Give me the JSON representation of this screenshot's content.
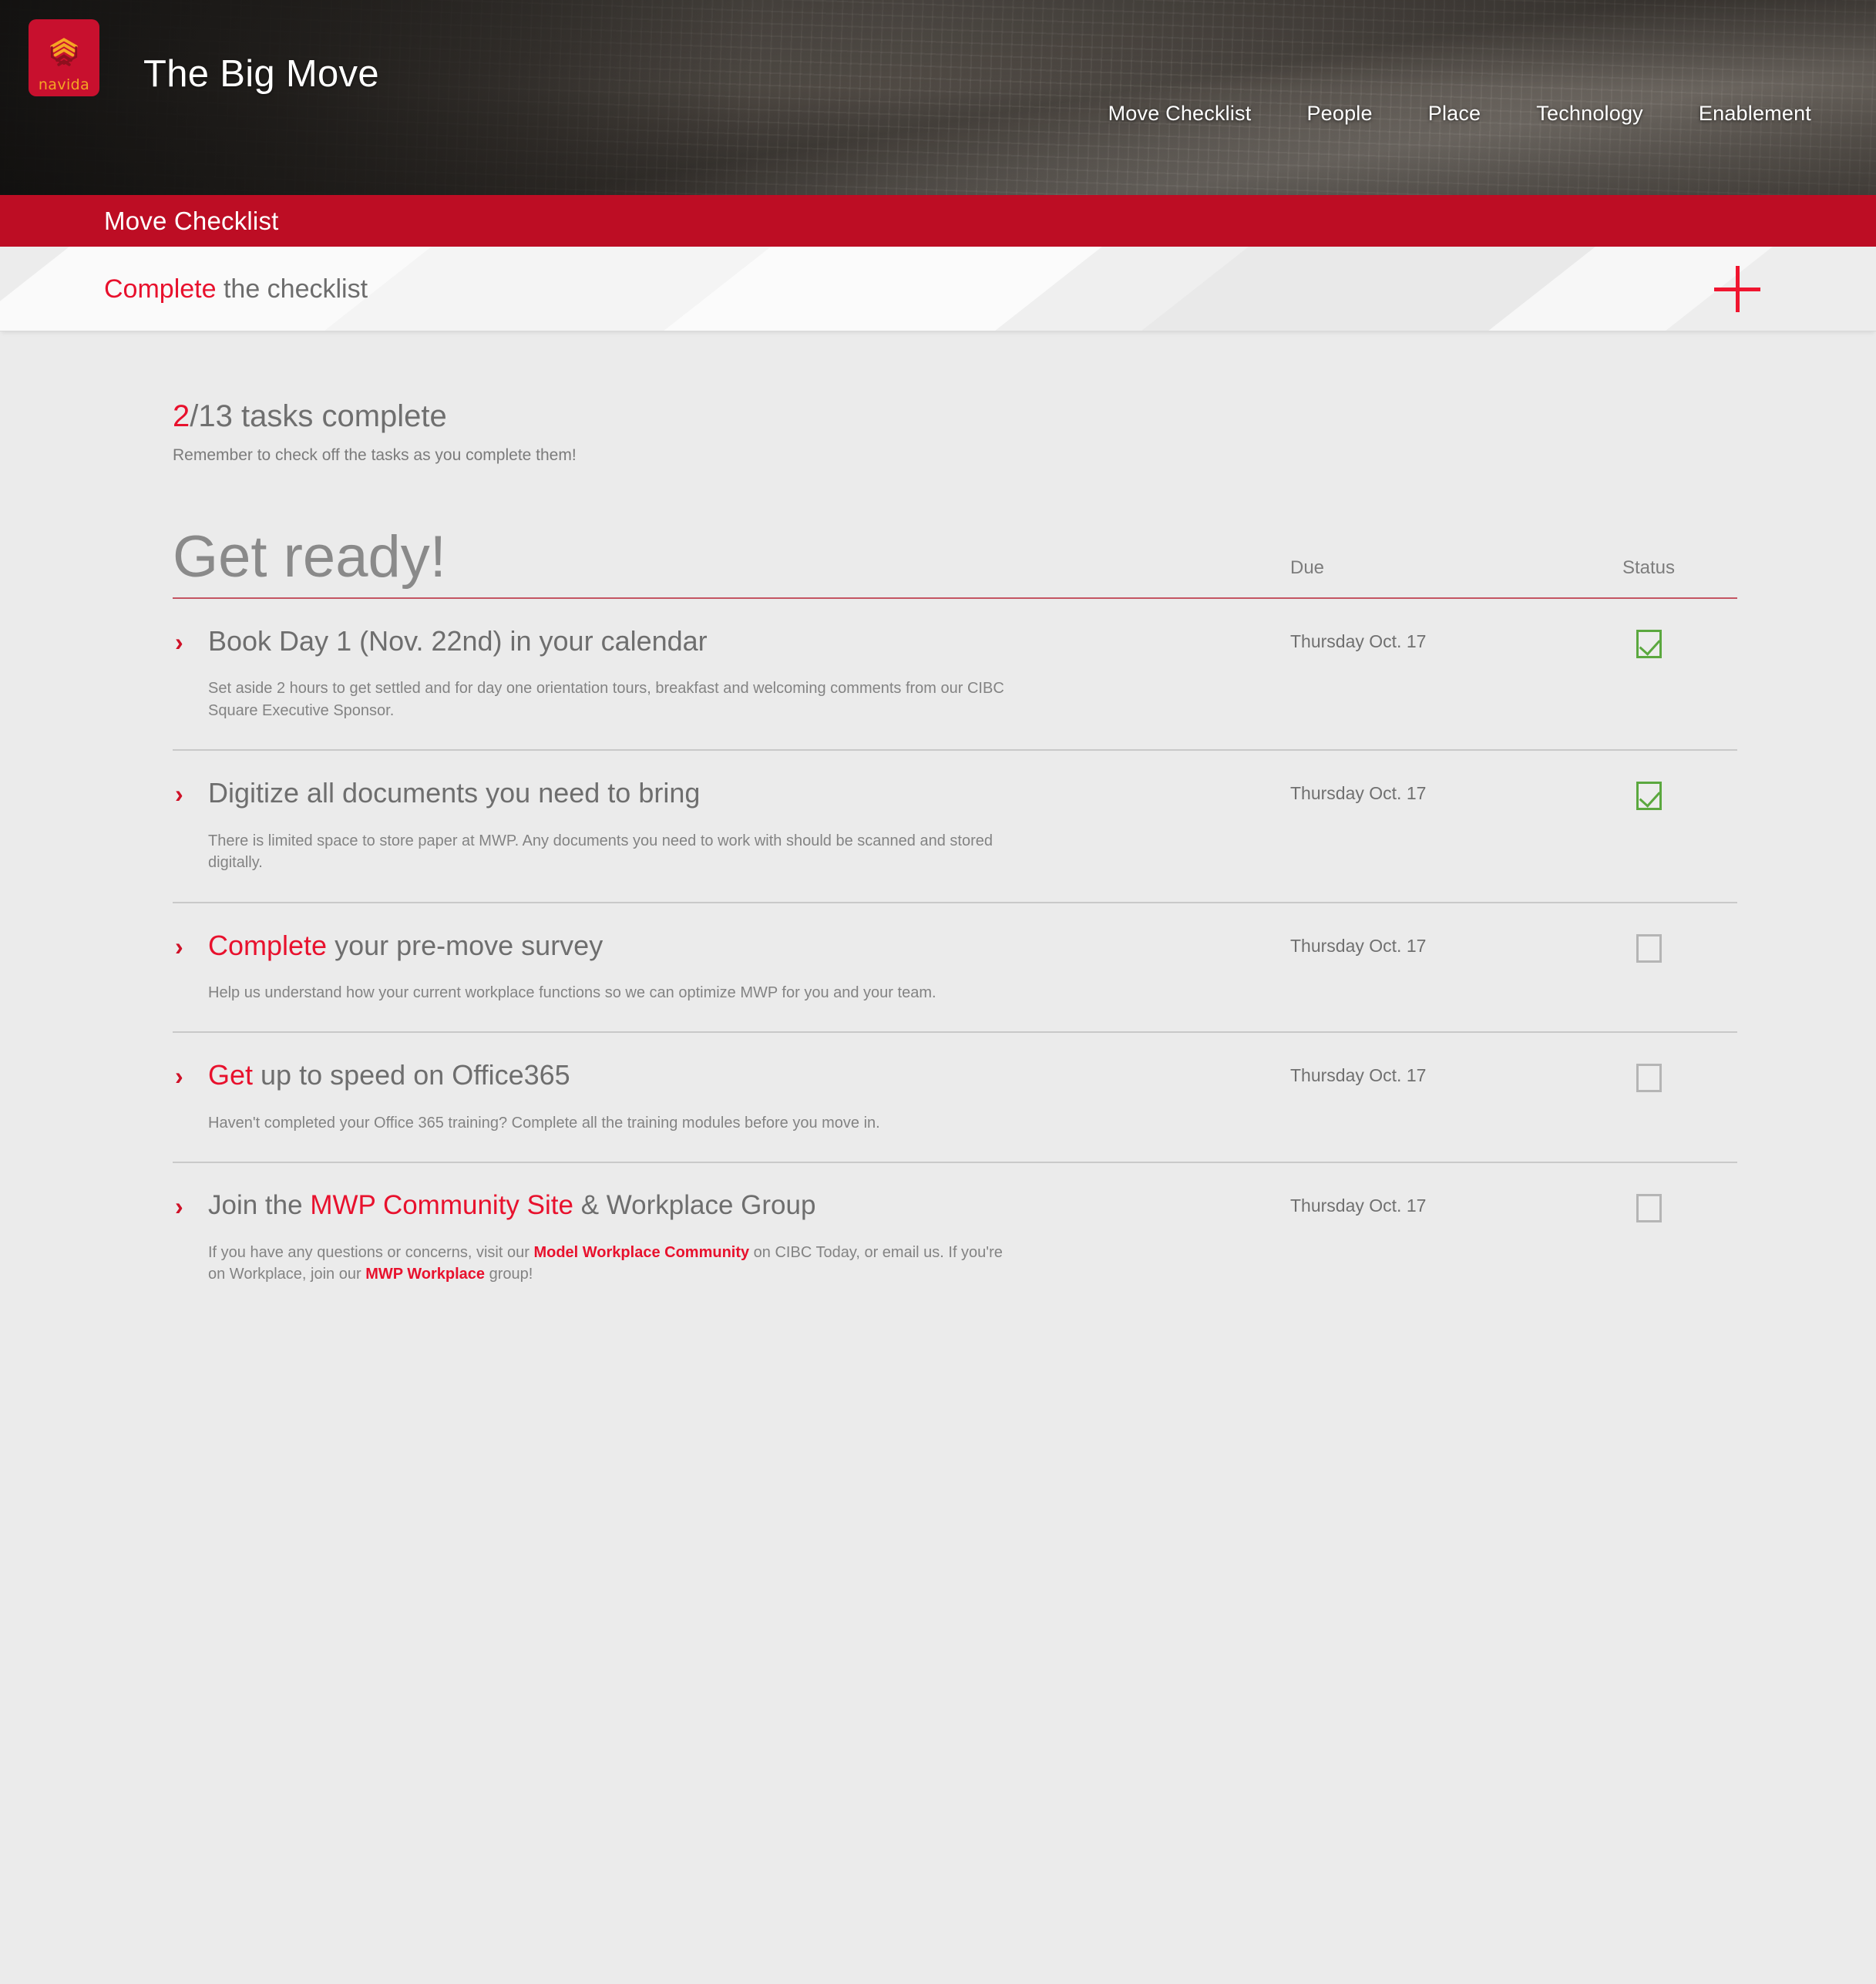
{
  "brand": {
    "logo_word": "navida",
    "logo_icon": "stacked-cube-logo",
    "accent_red": "#e8112d",
    "bar_red": "#bd0d24",
    "logo_red": "#c8102e",
    "logo_gold": "#f5a623",
    "check_green": "#5ba83f"
  },
  "banner": {
    "title": "The Big Move",
    "nav": [
      {
        "label": "Move Checklist"
      },
      {
        "label": "People"
      },
      {
        "label": "Place"
      },
      {
        "label": "Technology"
      },
      {
        "label": "Enablement"
      }
    ]
  },
  "redbar": {
    "title": "Move Checklist"
  },
  "subbar": {
    "highlight": "Complete",
    "rest": " the checklist",
    "add_icon": "plus-icon"
  },
  "progress": {
    "done": "2",
    "total_text": "/13 tasks complete",
    "reminder": "Remember to check off the tasks as you complete them!"
  },
  "section": {
    "title": "Get ready!",
    "col_due": "Due",
    "col_status": "Status"
  },
  "tasks": [
    {
      "chevron": "›",
      "title_plain_pre": "",
      "title_highlight": "",
      "title_plain_post": "Book Day 1 (Nov. 22nd) in your calendar",
      "desc": "Set aside 2 hours to get settled and for day one orientation tours, breakfast and welcoming comments from our CIBC Square Executive Sponsor.",
      "due": "Thursday Oct. 17",
      "checked": true
    },
    {
      "chevron": "›",
      "title_plain_pre": "",
      "title_highlight": "",
      "title_plain_post": "Digitize all documents you need to bring",
      "desc": "There is limited space to store paper at MWP. Any documents you need to work with should be scanned and stored digitally.",
      "due": "Thursday Oct. 17",
      "checked": true
    },
    {
      "chevron": "›",
      "title_plain_pre": "",
      "title_highlight": "Complete",
      "title_plain_post": " your pre-move survey",
      "desc": "Help us understand how your current workplace functions so we can optimize MWP for you and your team.",
      "due": "Thursday Oct. 17",
      "checked": false
    },
    {
      "chevron": "›",
      "title_plain_pre": "",
      "title_highlight": "Get",
      "title_plain_post": " up to speed on Office365",
      "desc": "Haven't completed your Office 365 training? Complete all the training modules before you move in.",
      "due": "Thursday Oct. 17",
      "checked": false
    },
    {
      "chevron": "›",
      "title_plain_pre": "Join the ",
      "title_highlight": "MWP Community Site",
      "title_plain_post": " & Workplace Group",
      "desc_parts": [
        {
          "text": "If you have any questions or concerns, visit our ",
          "link": false
        },
        {
          "text": "Model Workplace Community",
          "link": true
        },
        {
          "text": " on CIBC Today, or email us. If you're on Workplace, join our ",
          "link": false
        },
        {
          "text": "MWP Workplace",
          "link": true
        },
        {
          "text": " group!",
          "link": false
        }
      ],
      "due": "Thursday Oct. 17",
      "checked": false
    }
  ]
}
